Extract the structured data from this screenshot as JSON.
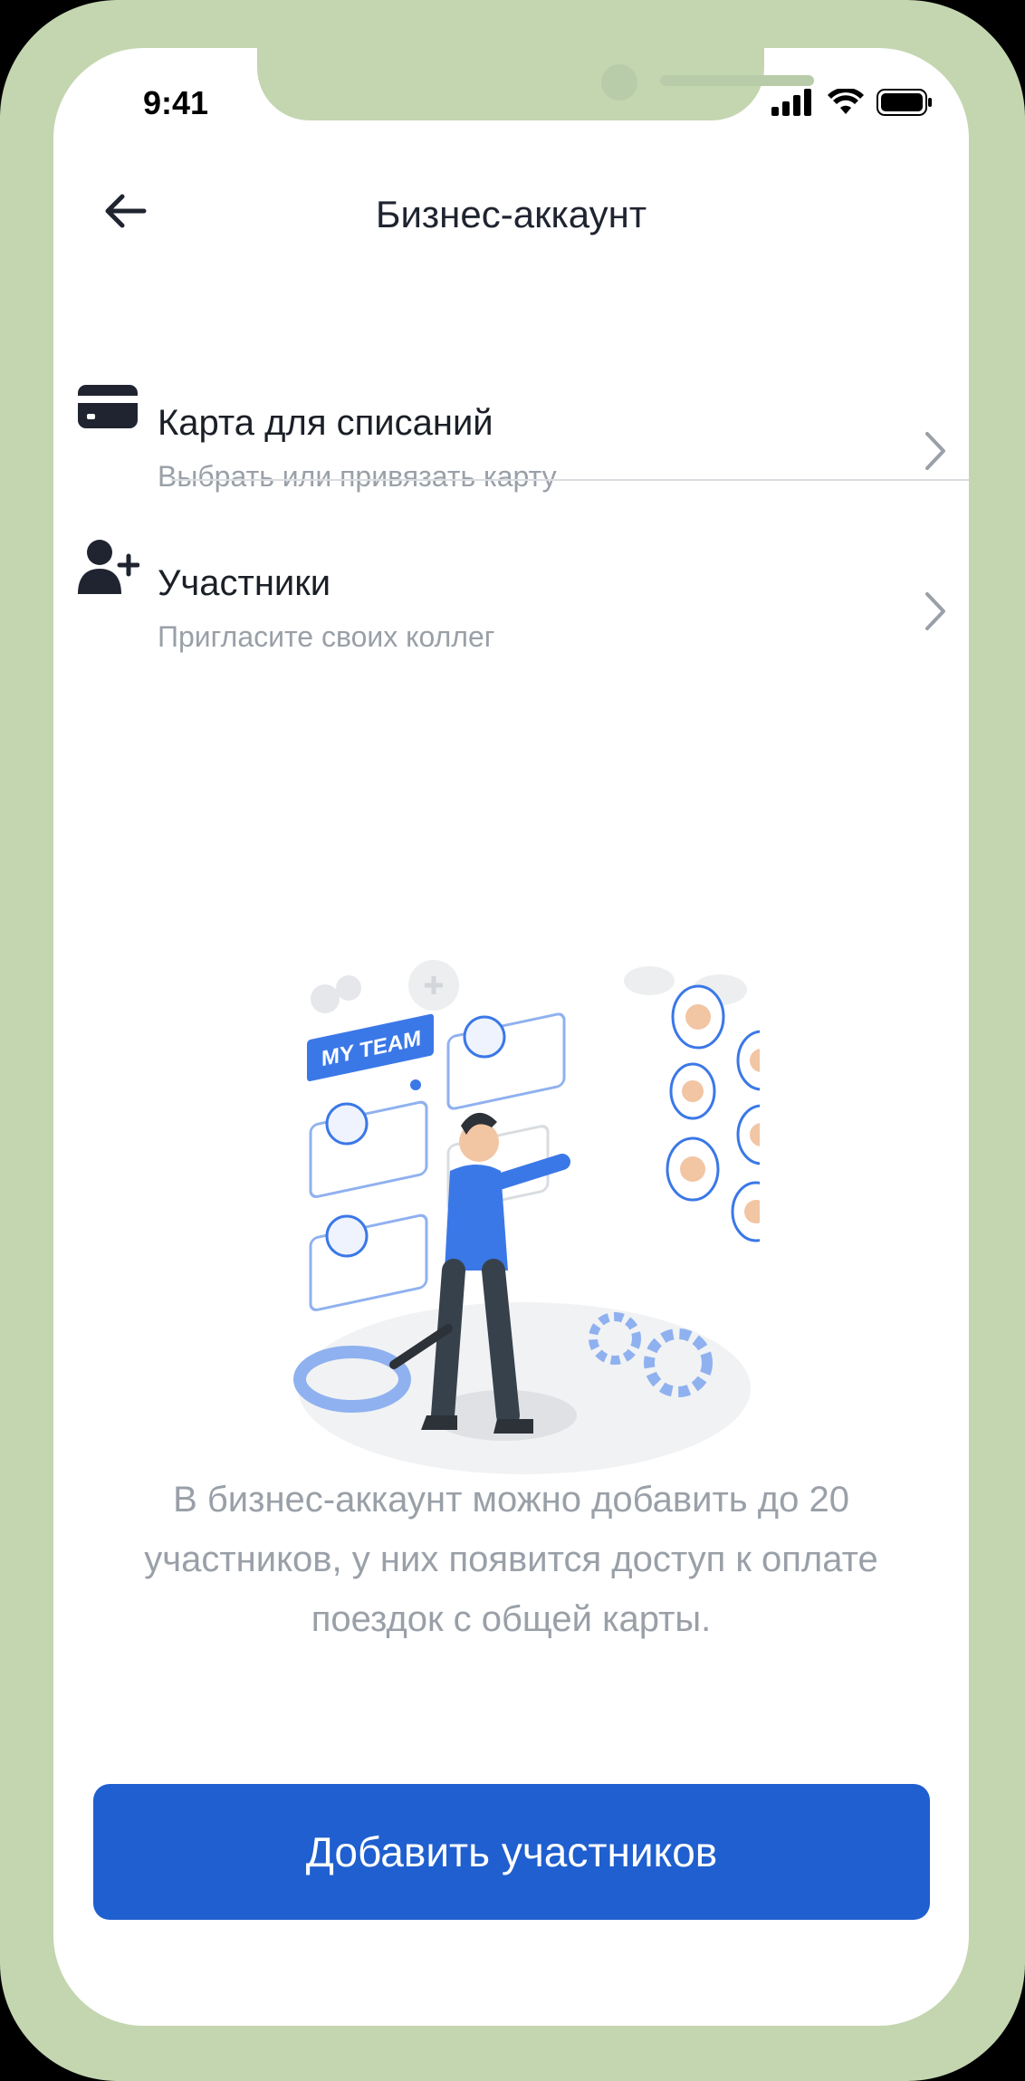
{
  "status_bar": {
    "time": "9:41"
  },
  "header": {
    "title": "Бизнес-аккаунт"
  },
  "menu": [
    {
      "title": "Карта для списаний",
      "subtitle": "Выбрать или привязать карту",
      "icon": "credit-card-icon"
    },
    {
      "title": "Участники",
      "subtitle": "Пригласите своих коллег",
      "icon": "add-user-icon"
    }
  ],
  "illustration": {
    "label": "MY TEAM"
  },
  "description": "В бизнес-аккаунт можно добавить до 20 участников, у них появится доступ к оплате поездок с общей карты.",
  "cta": {
    "label": "Добавить участников"
  },
  "colors": {
    "accent": "#1f5fcf",
    "frame": "#c3d6b0",
    "text": "#1b1f27",
    "muted": "#9aa0a8"
  }
}
